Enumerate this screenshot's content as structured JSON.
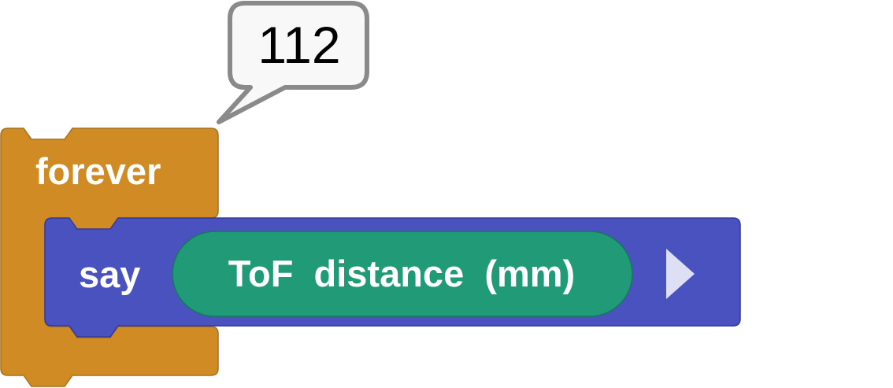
{
  "speech_bubble": {
    "value": "112"
  },
  "forever_block": {
    "label": "forever",
    "color": "#d08b25",
    "stroke": "#a8701b"
  },
  "say_block": {
    "label": "say",
    "color": "#4a52bf",
    "stroke": "#333a99",
    "arrow_color": "#dde0f5"
  },
  "reporter": {
    "label": "ToF  distance  (mm)",
    "color": "#219a78",
    "stroke": "#17775c"
  },
  "bubble_colors": {
    "fill": "#f8f8f8",
    "stroke": "#8a8a8a"
  }
}
